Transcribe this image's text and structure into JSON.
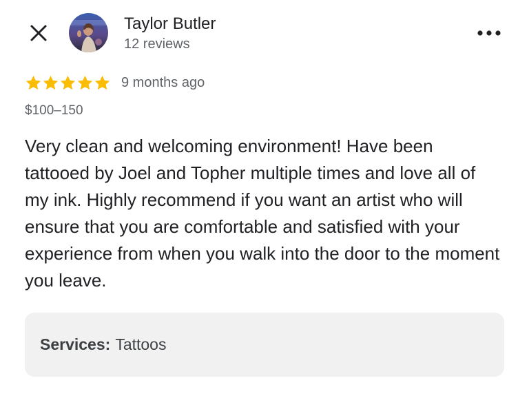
{
  "header": {
    "close_icon": "close-icon",
    "more_icon": "more-horizontal-icon"
  },
  "reviewer": {
    "name": "Taylor Butler",
    "review_count": "12 reviews",
    "avatar": "profile-photo"
  },
  "review": {
    "rating": 5,
    "rating_max": 5,
    "star_color": "#fbbc04",
    "date": "9 months ago",
    "price": "$100–150",
    "text": "Very clean and welcoming environment! Have been tattooed by Joel and Topher multiple times and love all of my ink. Highly recommend if you want an artist who will ensure that you are comfortable and satisfied with your experience from when you walk into the door to the moment you leave."
  },
  "services": {
    "label": "Services:",
    "value": "Tattoos"
  }
}
